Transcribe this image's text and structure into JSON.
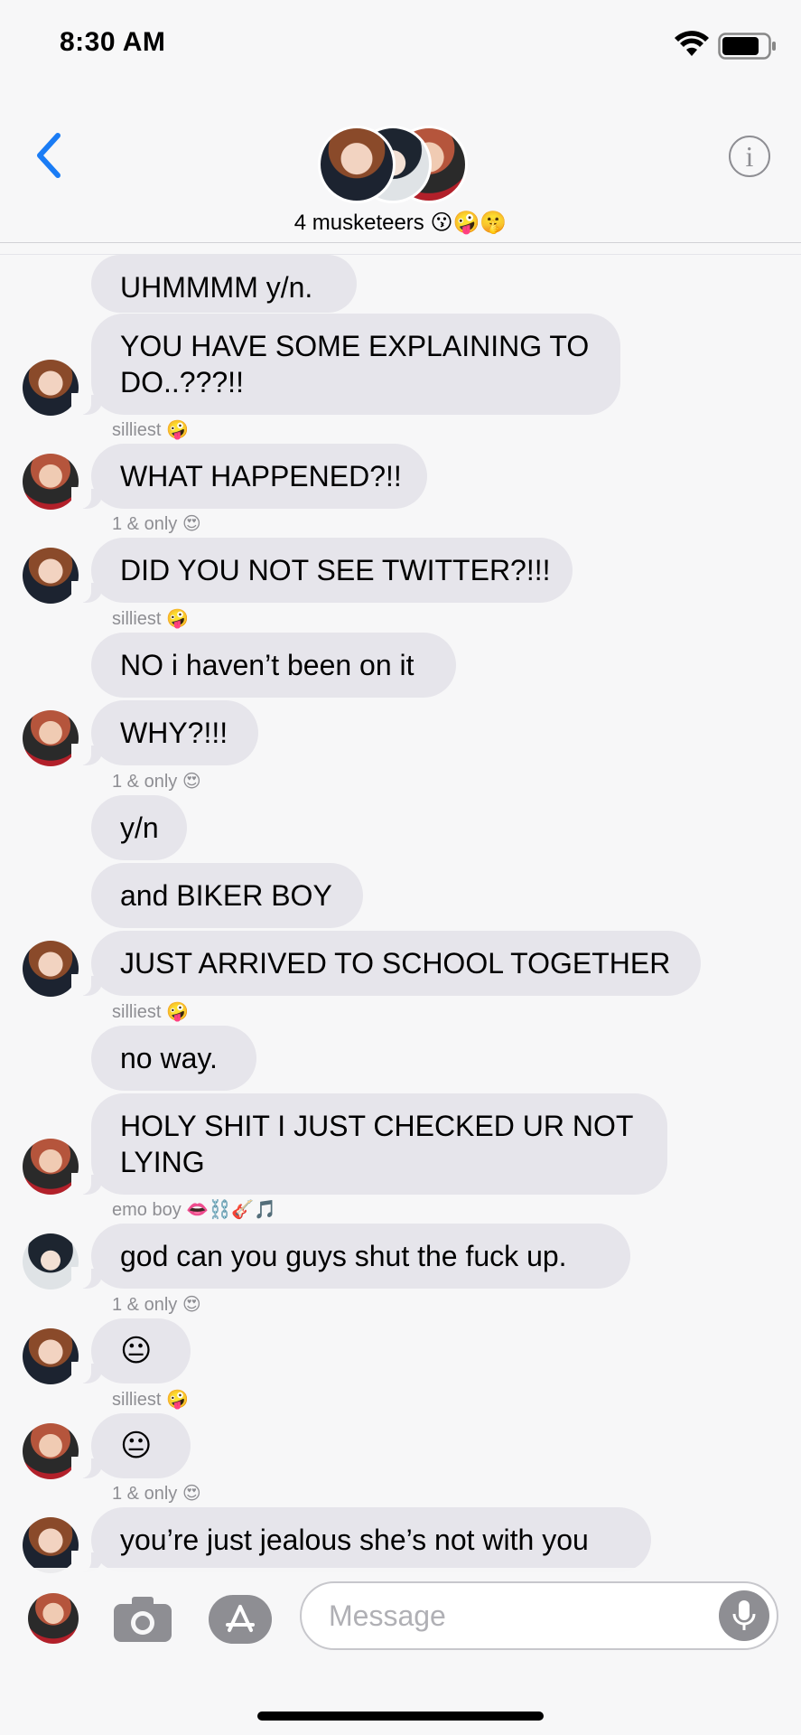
{
  "status": {
    "time": "8:30 AM"
  },
  "header": {
    "group_name": "4 musketeers 😗🤪🤫"
  },
  "messages": [
    {
      "text": "UHMMMM y/n."
    },
    {
      "text": "YOU HAVE SOME EXPLAINING TO DO..???!!"
    },
    {
      "sender": "silliest 🤪"
    },
    {
      "text": "WHAT HAPPENED?!!"
    },
    {
      "sender": "1 & only 😍"
    },
    {
      "text": "DID YOU NOT SEE TWITTER?!!!"
    },
    {
      "sender": "silliest 🤪"
    },
    {
      "text": "NO i haven’t been on it"
    },
    {
      "text": "WHY?!!!"
    },
    {
      "sender": "1 & only 😍"
    },
    {
      "text": "y/n"
    },
    {
      "text": "and BIKER BOY"
    },
    {
      "text": "JUST ARRIVED TO SCHOOL TOGETHER"
    },
    {
      "sender": "silliest 🤪"
    },
    {
      "text": "no way."
    },
    {
      "text": "HOLY SHIT I JUST CHECKED UR NOT LYING"
    },
    {
      "sender": "emo boy 👄⛓️🎸🎵"
    },
    {
      "text": "god can you guys shut the fuck up."
    },
    {
      "sender": "1 & only 😍"
    },
    {
      "text": "😐"
    },
    {
      "sender": "silliest 🤪"
    },
    {
      "text": "😐"
    },
    {
      "sender": "1 & only 😍"
    },
    {
      "text": "you’re just jealous she’s not with you"
    }
  ],
  "input": {
    "placeholder": "Message"
  },
  "icons": [
    "back-chevron-icon",
    "info-icon",
    "camera-icon",
    "app-store-icon",
    "microphone-icon",
    "wifi-icon",
    "battery-icon"
  ],
  "colors": {
    "accent": "#1a7cf5",
    "bubble": "#e6e5eb",
    "background": "#f7f7f8",
    "secondary_text": "#8e8e93"
  }
}
